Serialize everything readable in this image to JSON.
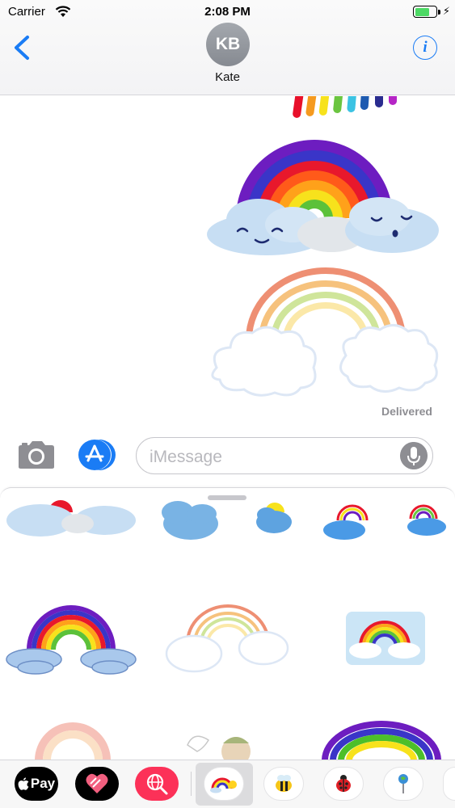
{
  "status_bar": {
    "carrier": "Carrier",
    "time": "2:08 PM",
    "battery_level": 0.7
  },
  "header": {
    "contact_initials": "KB",
    "contact_name": "Kate",
    "back_icon": "chevron-left-icon",
    "info_icon": "info-icon",
    "info_glyph": "i"
  },
  "conversation": {
    "messages": [
      {
        "type": "sticker",
        "sticker": "rainbow-marker-strokes"
      },
      {
        "type": "sticker",
        "sticker": "rainbow-with-smiling-clouds"
      },
      {
        "type": "sticker",
        "sticker": "pastel-rainbow-with-outline-clouds"
      }
    ],
    "delivered_label": "Delivered"
  },
  "composer": {
    "camera_icon": "camera-icon",
    "appstore_icon": "app-store-icon",
    "placeholder": "iMessage",
    "mic_icon": "microphone-icon"
  },
  "sticker_drawer": {
    "stickers": [
      "rainbow-clouds-partial",
      "blue-cloud",
      "small-blue-cloud",
      "rainbow-cloud-small",
      "rainbow-cloud-small-2",
      "rainbow-blue-clouds",
      "pastel-rainbow-outline-clouds",
      "watercolor-rainbow",
      "pink-rainbow-partial",
      "cherub-partial",
      "bright-rainbow-partial"
    ]
  },
  "app_tray": {
    "apple_pay_label": "Pay",
    "apps": [
      "apple-pay",
      "heart-sticker-app",
      "globe-search-app",
      "rainbow-sticker-app",
      "bee-sticker-app",
      "ladybug-sticker-app",
      "pin-sticker-app"
    ]
  },
  "colors": {
    "ios_blue": "#1a7cf5",
    "battery_green": "#4cd964",
    "globe_app_pink": "#fc3158"
  }
}
